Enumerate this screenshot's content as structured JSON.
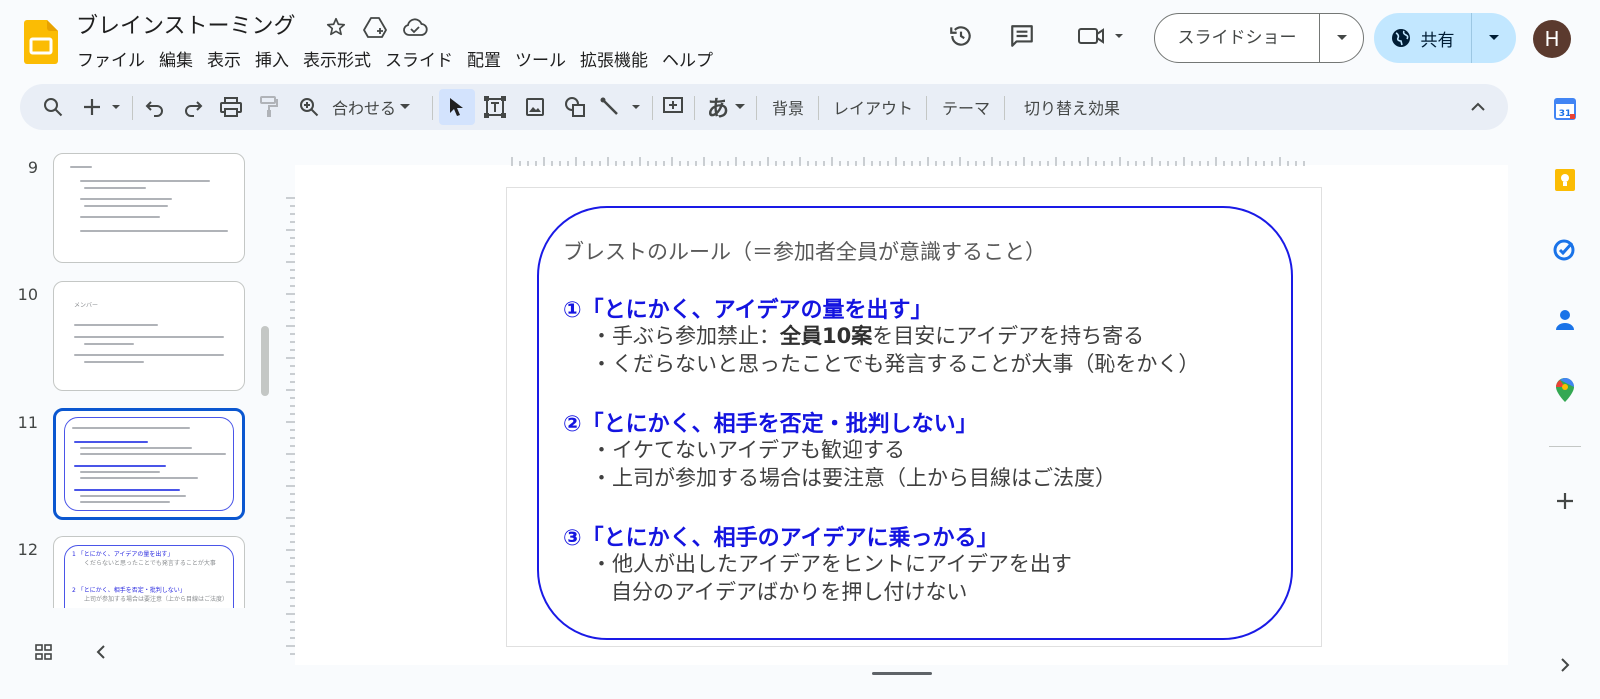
{
  "app": {
    "title": "ブレインストーミング",
    "avatar_letter": "H",
    "accent": "#0b57d0",
    "share_bg": "#c2e7ff"
  },
  "menu": [
    "ファイル",
    "編集",
    "表示",
    "挿入",
    "表示形式",
    "スライド",
    "配置",
    "ツール",
    "拡張機能",
    "ヘルプ"
  ],
  "header": {
    "slideshow_label": "スライドショー",
    "share_label": "共有"
  },
  "toolbar": {
    "zoom_label": "合わせる",
    "font_label": "あ",
    "background": "背景",
    "layout": "レイアウト",
    "theme": "テーマ",
    "transition": "切り替え効果"
  },
  "filmstrip": {
    "slides": [
      {
        "number": "9"
      },
      {
        "number": "10",
        "heading": "メンバー"
      },
      {
        "number": "11",
        "selected": true
      },
      {
        "number": "12",
        "lines": [
          "1 「とにかく、アイデアの量を出す」",
          "くだらないと思ったことでも発言することが大事",
          "2 「とにかく、相手を否定・批判しない」",
          "上司が参加する場合は要注意（上から目線はご法度）"
        ]
      }
    ]
  },
  "slide": {
    "title": "ブレストのルール（＝参加者全員が意識すること）",
    "rule1": {
      "heading": "①「とにかく、アイデアの量を出す」",
      "b1_pre": "・手ぶら参加禁止：",
      "b1_bold": "全員10案",
      "b1_post": "を目安にアイデアを持ち寄る",
      "b2": "・くだらないと思ったことでも発言することが大事（恥をかく）"
    },
    "rule2": {
      "heading": "②「とにかく、相手を否定・批判しない」",
      "b1": "・イケてないアイデアも歓迎する",
      "b2": "・上司が参加する場合は要注意（上から目線はご法度）"
    },
    "rule3": {
      "heading": "③「とにかく、相手のアイデアに乗っかる」",
      "b1": "・他人が出したアイデアをヒントにアイデアを出す",
      "b2": "自分のアイデアばかりを押し付けない"
    },
    "border_color": "#1a1ae6"
  }
}
